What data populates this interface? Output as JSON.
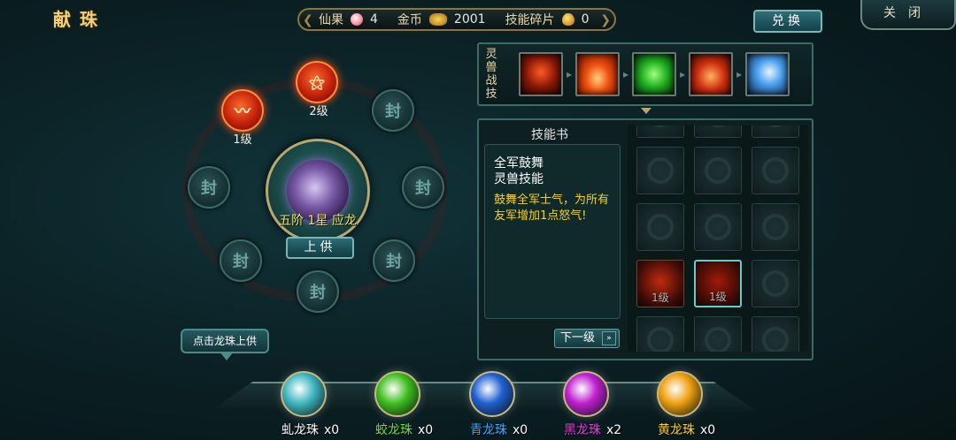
{
  "header": {
    "title": "献珠",
    "resources": [
      {
        "label": "仙果",
        "icon": "fairy-fruit-icon",
        "value": "4"
      },
      {
        "label": "金币",
        "icon": "gold-coin-icon",
        "value": "2001"
      },
      {
        "label": "技能碎片",
        "icon": "skill-shard-icon",
        "value": "0"
      }
    ],
    "exchange_label": "兑换",
    "close_label": "关闭"
  },
  "orb_ring": {
    "slots": [
      {
        "id": "top",
        "glyph": "⚝",
        "state": "active",
        "level": "2级"
      },
      {
        "id": "upper-left",
        "glyph": "〰",
        "state": "active",
        "level": "1级"
      },
      {
        "id": "upper-right",
        "glyph": "封",
        "state": "sealed",
        "level": ""
      },
      {
        "id": "left",
        "glyph": "封",
        "state": "sealed",
        "level": ""
      },
      {
        "id": "right",
        "glyph": "封",
        "state": "sealed",
        "level": ""
      },
      {
        "id": "lower-left",
        "glyph": "封",
        "state": "sealed",
        "level": ""
      },
      {
        "id": "lower-right",
        "glyph": "封",
        "state": "sealed",
        "level": ""
      },
      {
        "id": "bottom",
        "glyph": "封",
        "state": "sealed",
        "level": ""
      }
    ],
    "center_label": "五阶 1星 应龙",
    "offer_label": "上供",
    "hint": "点击龙珠上供"
  },
  "spirit_skills": {
    "tag": "灵兽战技",
    "icons": [
      {
        "name": "demon-face-skill-icon",
        "color": "#b02010"
      },
      {
        "name": "fire-pillar-skill-icon",
        "color": "#e04a10"
      },
      {
        "name": "green-dragon-skill-icon",
        "color": "#20c030"
      },
      {
        "name": "fire-warrior-skill-icon",
        "color": "#d03010"
      },
      {
        "name": "lightning-skill-icon",
        "color": "#3a8ae0"
      }
    ]
  },
  "skill_book": {
    "title": "技能书",
    "selected": {
      "name": "全军鼓舞",
      "type": "灵兽技能",
      "description": "鼓舞全军士气，为所有友军增加1点怒气!"
    },
    "next_label": "下一级",
    "cells": [
      {
        "state": "locked"
      },
      {
        "state": "locked"
      },
      {
        "state": "locked"
      },
      {
        "state": "locked"
      },
      {
        "state": "locked"
      },
      {
        "state": "locked"
      },
      {
        "state": "locked"
      },
      {
        "state": "locked"
      },
      {
        "state": "locked"
      },
      {
        "state": "filled",
        "level": "1级",
        "icon": "fire-warrior-skill-icon",
        "color": "#c02a10"
      },
      {
        "state": "selected",
        "level": "1级",
        "icon": "demon-face-skill-icon",
        "color": "#a01a0a"
      },
      {
        "state": "locked"
      },
      {
        "state": "locked"
      },
      {
        "state": "locked"
      },
      {
        "state": "locked"
      }
    ]
  },
  "dragon_pearls": [
    {
      "name": "虬龙珠",
      "count": "x0",
      "label_color": "#ffffff",
      "color": "#40b8c0"
    },
    {
      "name": "蛟龙珠",
      "count": "x0",
      "label_color": "#6fe040",
      "color": "#40c020"
    },
    {
      "name": "青龙珠",
      "count": "x0",
      "label_color": "#40a8ff",
      "color": "#2060d0"
    },
    {
      "name": "黑龙珠",
      "count": "x2",
      "label_color": "#e040e0",
      "color": "#c020d0"
    },
    {
      "name": "黄龙珠",
      "count": "x0",
      "label_color": "#ffd030",
      "color": "#f0a010"
    }
  ]
}
